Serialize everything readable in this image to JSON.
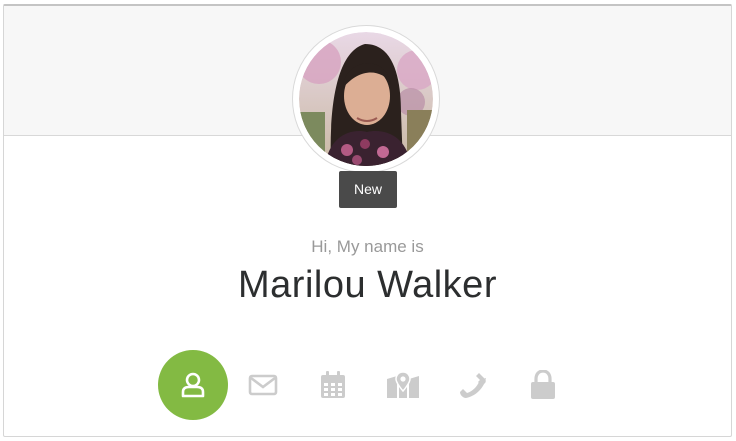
{
  "profile": {
    "badge": "New",
    "greeting": "Hi, My name is",
    "name": "Marilou Walker"
  },
  "tabs": [
    {
      "icon": "user-icon",
      "active": true
    },
    {
      "icon": "envelope-icon",
      "active": false
    },
    {
      "icon": "calendar-icon",
      "active": false
    },
    {
      "icon": "map-icon",
      "active": false
    },
    {
      "icon": "phone-icon",
      "active": false
    },
    {
      "icon": "lock-icon",
      "active": false
    }
  ],
  "colors": {
    "accent": "#83ba43",
    "icon_inactive": "#cccccc",
    "badge_bg": "#4a4a4a"
  }
}
